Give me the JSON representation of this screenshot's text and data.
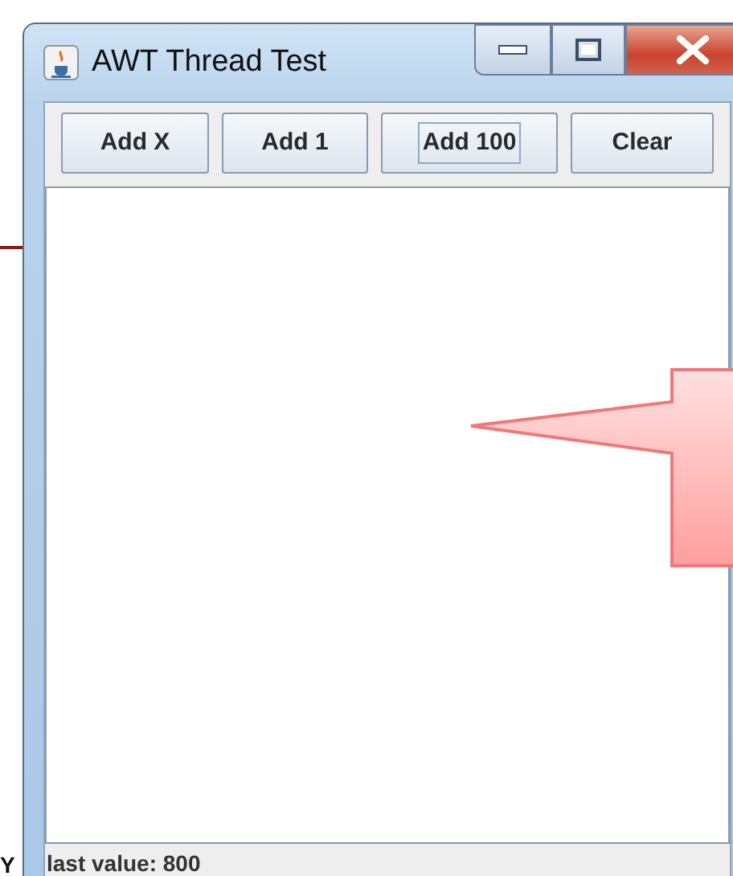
{
  "window": {
    "title": "AWT Thread Test"
  },
  "buttons": [
    {
      "label": "Add X",
      "focused": false
    },
    {
      "label": "Add 1",
      "focused": false
    },
    {
      "label": "Add 100",
      "focused": true
    },
    {
      "label": "Clear",
      "focused": false
    }
  ],
  "status_bar": "last value: 800",
  "outside_text": "Y"
}
